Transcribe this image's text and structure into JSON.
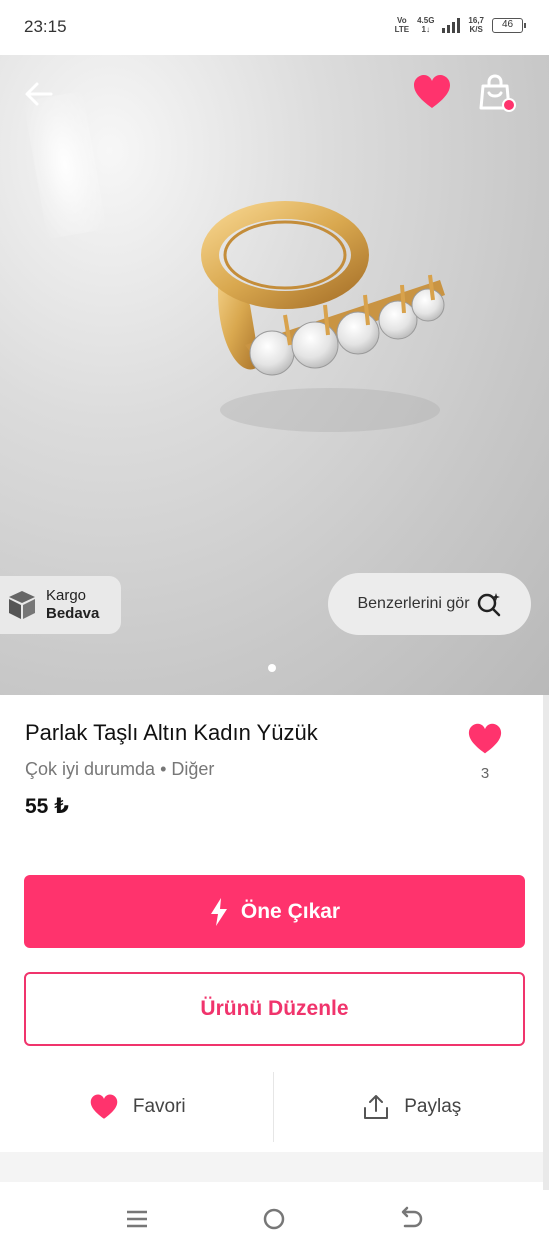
{
  "status_bar": {
    "time": "23:15",
    "carrier_top": "Vo",
    "carrier_bottom": "LTE",
    "network_top": "4.5G",
    "network_bottom": "1↓",
    "speed_top": "16,7",
    "speed_bottom": "K/S",
    "battery": "46"
  },
  "hero": {
    "kargo_line1": "Kargo",
    "kargo_line2": "Bedava",
    "similar_label": "Benzerlerini gör",
    "icons": [
      "back-arrow-icon",
      "heart-icon",
      "shopping-bag-icon",
      "package-box-icon",
      "search-sparkle-icon"
    ]
  },
  "product": {
    "title": "Parlak Taşlı Altın Kadın Yüzük",
    "condition": "Çok iyi durumda",
    "separator": "•",
    "category": "Diğer",
    "price": "55 ₺",
    "like_count": "3"
  },
  "buttons": {
    "promote_label": "Öne Çıkar",
    "edit_label": "Ürünü Düzenle"
  },
  "actions": {
    "favorite_label": "Favori",
    "share_label": "Paylaş"
  },
  "colors": {
    "accent": "#ff336d",
    "accent_outline": "#f0346c",
    "text_dark": "#111111",
    "text_muted": "#777777"
  }
}
